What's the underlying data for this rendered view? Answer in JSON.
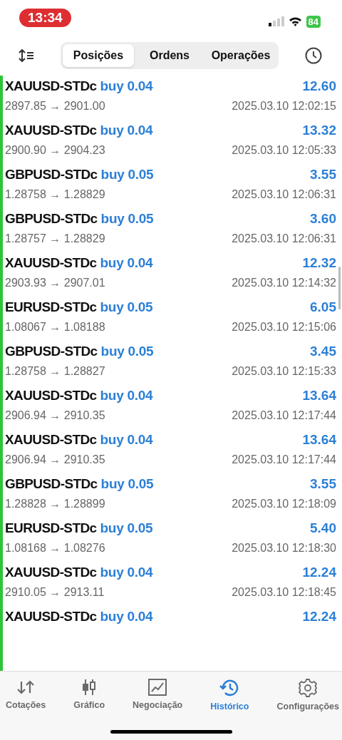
{
  "status_bar": {
    "time": "13:34",
    "battery": "84"
  },
  "segments": [
    {
      "label": "Posições",
      "selected": true
    },
    {
      "label": "Ordens",
      "selected": false
    },
    {
      "label": "Operações",
      "selected": false
    }
  ],
  "deals": [
    {
      "symbol": "XAUUSD-STDc",
      "side": "buy 0.04",
      "profit": "12.60",
      "prices": "2897.85 → 2901.00",
      "time": "2025.03.10 12:02:15"
    },
    {
      "symbol": "XAUUSD-STDc",
      "side": "buy 0.04",
      "profit": "13.32",
      "prices": "2900.90 → 2904.23",
      "time": "2025.03.10 12:05:33"
    },
    {
      "symbol": "GBPUSD-STDc",
      "side": "buy 0.05",
      "profit": "3.55",
      "prices": "1.28758 → 1.28829",
      "time": "2025.03.10 12:06:31"
    },
    {
      "symbol": "GBPUSD-STDc",
      "side": "buy 0.05",
      "profit": "3.60",
      "prices": "1.28757 → 1.28829",
      "time": "2025.03.10 12:06:31"
    },
    {
      "symbol": "XAUUSD-STDc",
      "side": "buy 0.04",
      "profit": "12.32",
      "prices": "2903.93 → 2907.01",
      "time": "2025.03.10 12:14:32"
    },
    {
      "symbol": "EURUSD-STDc",
      "side": "buy 0.05",
      "profit": "6.05",
      "prices": "1.08067 → 1.08188",
      "time": "2025.03.10 12:15:06"
    },
    {
      "symbol": "GBPUSD-STDc",
      "side": "buy 0.05",
      "profit": "3.45",
      "prices": "1.28758 → 1.28827",
      "time": "2025.03.10 12:15:33"
    },
    {
      "symbol": "XAUUSD-STDc",
      "side": "buy 0.04",
      "profit": "13.64",
      "prices": "2906.94 → 2910.35",
      "time": "2025.03.10 12:17:44"
    },
    {
      "symbol": "XAUUSD-STDc",
      "side": "buy 0.04",
      "profit": "13.64",
      "prices": "2906.94 → 2910.35",
      "time": "2025.03.10 12:17:44"
    },
    {
      "symbol": "GBPUSD-STDc",
      "side": "buy 0.05",
      "profit": "3.55",
      "prices": "1.28828 → 1.28899",
      "time": "2025.03.10 12:18:09"
    },
    {
      "symbol": "EURUSD-STDc",
      "side": "buy 0.05",
      "profit": "5.40",
      "prices": "1.08168 → 1.08276",
      "time": "2025.03.10 12:18:30"
    },
    {
      "symbol": "XAUUSD-STDc",
      "side": "buy 0.04",
      "profit": "12.24",
      "prices": "2910.05 → 2913.11",
      "time": "2025.03.10 12:18:45"
    },
    {
      "symbol": "XAUUSD-STDc",
      "side": "buy 0.04",
      "profit": "12.24"
    }
  ],
  "tab_bar": [
    {
      "label": "Cotações",
      "kind": "quotes",
      "selected": false
    },
    {
      "label": "Gráfico",
      "kind": "chart",
      "selected": false
    },
    {
      "label": "Negociação",
      "kind": "trade",
      "selected": false
    },
    {
      "label": "Histórico",
      "kind": "history",
      "selected": true
    },
    {
      "label": "Configurações",
      "kind": "settings",
      "selected": false
    }
  ]
}
